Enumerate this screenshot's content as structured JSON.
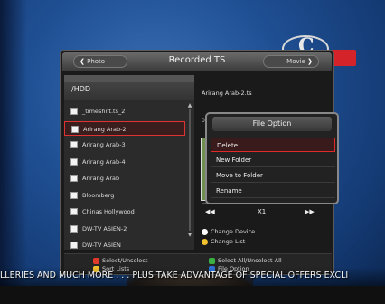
{
  "window": {
    "title": "Recorded TS",
    "nav_left": "Photo",
    "nav_right": "Movie"
  },
  "list": {
    "path": "/HDD",
    "items": [
      {
        "label": "_timeshift.ts_2",
        "selected": false
      },
      {
        "label": "Arirang Arab-2",
        "selected": true
      },
      {
        "label": "Arirang Arab-3",
        "selected": false
      },
      {
        "label": "Arirang Arab-4",
        "selected": false
      },
      {
        "label": "Arirang Arab",
        "selected": false
      },
      {
        "label": "Bloomberg",
        "selected": false
      },
      {
        "label": "Chinas Hollywood",
        "selected": false
      },
      {
        "label": "DW-TV ASIEN-2",
        "selected": false
      },
      {
        "label": "DW-TV ASIEN",
        "selected": false
      }
    ]
  },
  "preview": {
    "filename": "Arirang Arab-2.ts",
    "time": "00:",
    "speed": "X1",
    "rewind_icon": "rewind-icon",
    "forward_icon": "fast-forward-icon",
    "options": [
      {
        "label": "Change Device",
        "color": "#ffffff"
      },
      {
        "label": "Change List",
        "color": "#f2c12e"
      }
    ]
  },
  "popup": {
    "title": "File Option",
    "items": [
      "Delete",
      "New Folder",
      "Move to Folder",
      "Rename"
    ],
    "active_index": 0
  },
  "legend": {
    "items": [
      {
        "label": "Select/Unselect",
        "color": "#e03a2a"
      },
      {
        "label": "Sort Lists",
        "color": "#f2c12e"
      },
      {
        "label": "Select All/Unselect All",
        "color": "#3cb043"
      },
      {
        "label": "File Option",
        "color": "#2d6fd6"
      }
    ]
  },
  "ticker": {
    "text": "LLERIES AND MUCH MORE . . . PLUS TAKE ADVANTAGE OF SPECIAL OFFERS EXCLI"
  },
  "colors": {
    "accent": "#d5232a",
    "panel": "#1a1a1a"
  }
}
